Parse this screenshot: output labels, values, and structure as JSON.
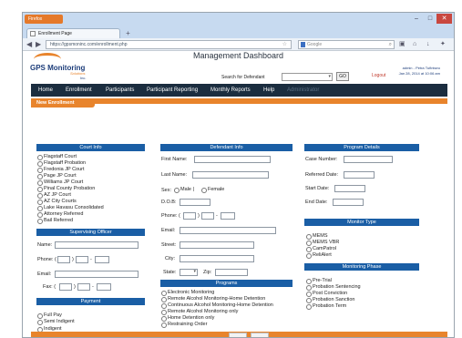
{
  "browser": {
    "app_button": "Firefox",
    "tab_title": "Enrollment Page",
    "new_tab_glyph": "+",
    "url": "https://gpsmoninc.com/enrollment.php",
    "search_engine": "Google",
    "win_min": "–",
    "win_max": "□",
    "win_close": "✕",
    "back_glyph": "◀",
    "forward_glyph": "▶"
  },
  "header": {
    "logo_text": "GPS Monitoring",
    "logo_sub": "Solutions",
    "logo_inc": "Inc.",
    "title": "Management Dashboard",
    "search_label": "Search for   Defendant",
    "defendant_select_value": "",
    "go_label": "GO",
    "logout_label": "Logout",
    "user_name": "admin - Petra Tufintseo",
    "user_date": "Jan 28, 2014 at 10:06 am"
  },
  "mainnav": [
    "Home",
    "Enrollment",
    "Participants",
    "Participant Reporting",
    "Monthly Reports",
    "Help",
    "Administrator"
  ],
  "section_tab": "New Enrollment",
  "court_info": {
    "header": "Court Info",
    "options": [
      "Flagstaff Court",
      "Flagstaff Probation",
      "Fredonia JP Court",
      "Page JP Court",
      "Williams JP Court",
      "Pinal County Probation",
      "AZ JP Court",
      "AZ City Courts",
      "Lake Havasu Consolidated",
      "Attorney Referred",
      "Bail Referred"
    ]
  },
  "supervising_officer": {
    "header": "Supervising Officer",
    "name_label": "Name:",
    "phone_label": "Phone: (",
    "phone_sep1": ")",
    "phone_sep2": "-",
    "email_label": "Email:",
    "fax_label": "Fax: (",
    "fax_sep1": ")",
    "fax_sep2": "-"
  },
  "payment": {
    "header": "Payment",
    "options": [
      "Full Pay",
      "Semi Indigent",
      "Indigent"
    ]
  },
  "defendant_info": {
    "header": "Defendant Info",
    "first_name_label": "First Name:",
    "last_name_label": "Last Name:",
    "sex_label": "Sex:",
    "sex_male": "Male |",
    "sex_female": "Female",
    "dob_label": "D.O.B:",
    "phone_label": "Phone: (",
    "phone_sep1": ")",
    "phone_sep2": "-",
    "email_label": "Email:",
    "street_label": "Street:",
    "city_label": "City:",
    "state_label": "State:",
    "state_value": "",
    "zip_label": "Zip:"
  },
  "programs": {
    "header": "Programs",
    "options": [
      "Electronic Monitoring",
      "Remote Alcohol Monitoring-Home Detention",
      "Continuous Alcohol Monitoring-Home Detention",
      "Remote Alcohol Monitoring only",
      "Home Detention only",
      "Restraining Order"
    ]
  },
  "program_details": {
    "header": "Program Details",
    "case_number_label": "Case Number:",
    "referred_date_label": "Referred Date:",
    "start_date_label": "Start Date:",
    "end_date_label": "End Date:"
  },
  "monitor_type": {
    "header": "Monitor Type",
    "options": [
      "MEMS",
      "MEMS VBR",
      "CamPatrol",
      "ReliAlert"
    ]
  },
  "monitoring_phase": {
    "header": "Monitoring Phase",
    "options": [
      "Pre-Trial",
      "Probation Sentencing",
      "Post Conviction",
      "Probation Sanction",
      "Probation Term"
    ]
  },
  "colors": {
    "brand_orange": "#e8842c",
    "nav_dark": "#1b2d3f",
    "header_blue": "#1a5ea5",
    "logout_red": "#c0392b"
  }
}
